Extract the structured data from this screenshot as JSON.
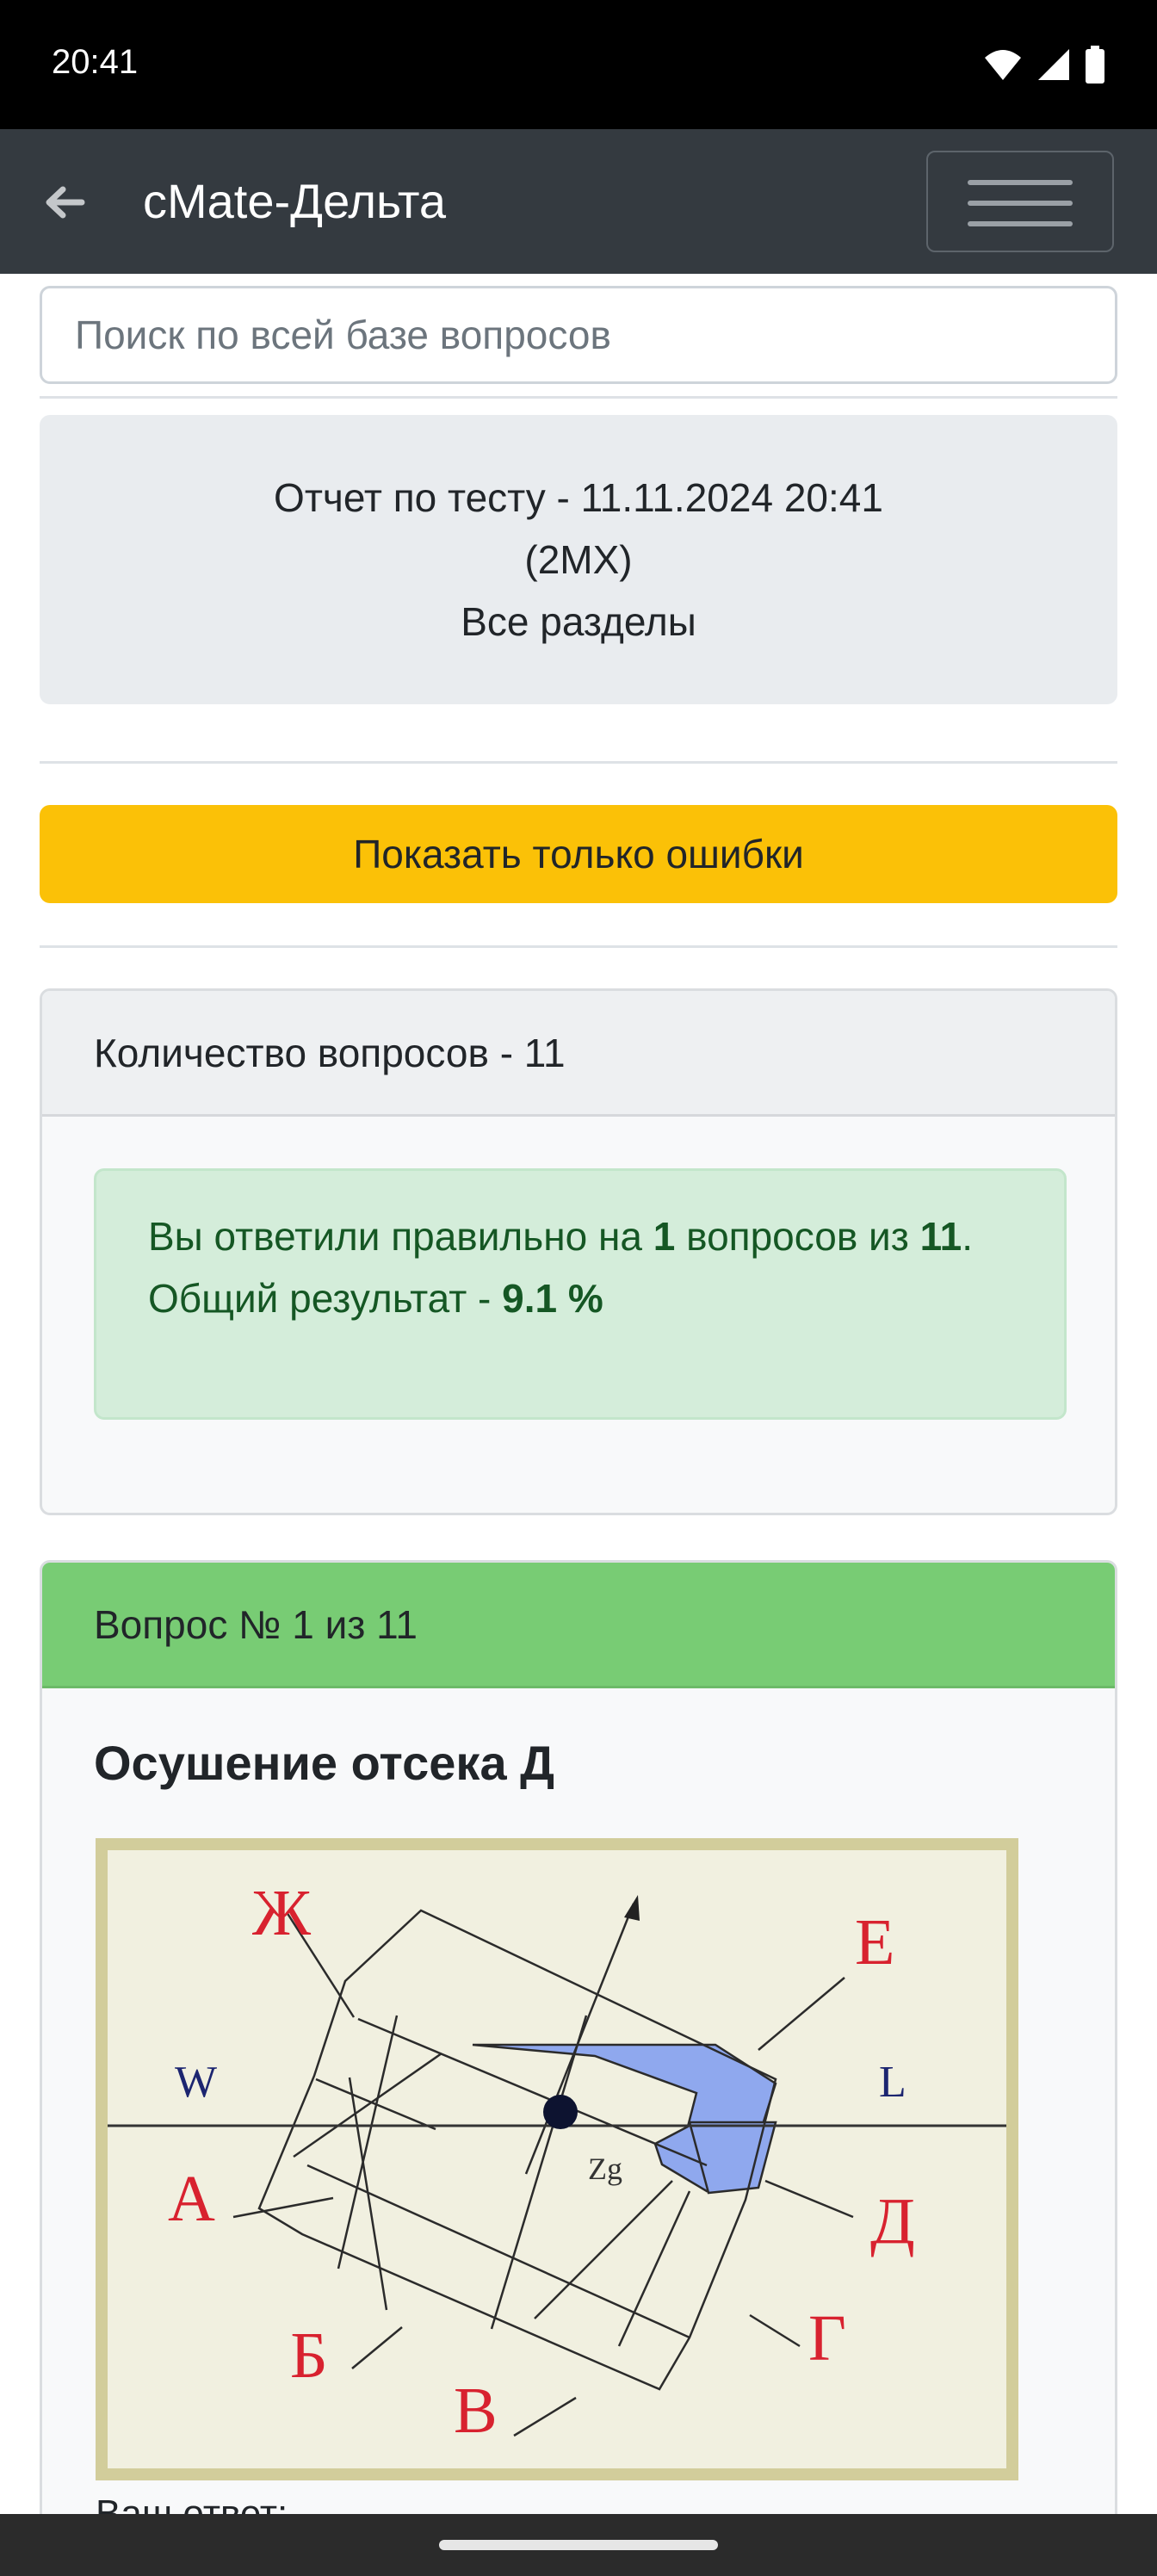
{
  "status": {
    "time": "20:41"
  },
  "header": {
    "title": "сMate-Дельта"
  },
  "search": {
    "placeholder": "Поиск по всей базе вопросов"
  },
  "report": {
    "line1": "Отчет по тесту - 11.11.2024 20:41",
    "line2": "(2MX)",
    "line3": "Все разделы"
  },
  "actions": {
    "show_errors": "Показать только ошибки"
  },
  "summary": {
    "header": "Количество вопросов - 11",
    "text_before": "Вы ответили правильно на ",
    "correct": "1",
    "text_middle": " вопросов из ",
    "total": "11",
    "text_after": ".",
    "result_label": "Общий результат - ",
    "result_value": "9.1 %"
  },
  "question": {
    "header": "Вопрос № 1 из 11",
    "title": "Осушение отсека Д",
    "answer_label": "Ваш ответ:",
    "figure_labels": {
      "zh": "Ж",
      "e": "Е",
      "w": "W",
      "l": "L",
      "a": "А",
      "zg": "Zg",
      "d": "Д",
      "b": "Б",
      "g": "Г",
      "v": "В"
    }
  },
  "colors": {
    "appbar": "#343a40",
    "warning": "#fbc107",
    "success_header": "#78cc74",
    "alert_bg": "#d4edda",
    "alert_text": "#155724",
    "figure_label": "#d8222f",
    "figure_fill": "#8fa8ee"
  }
}
